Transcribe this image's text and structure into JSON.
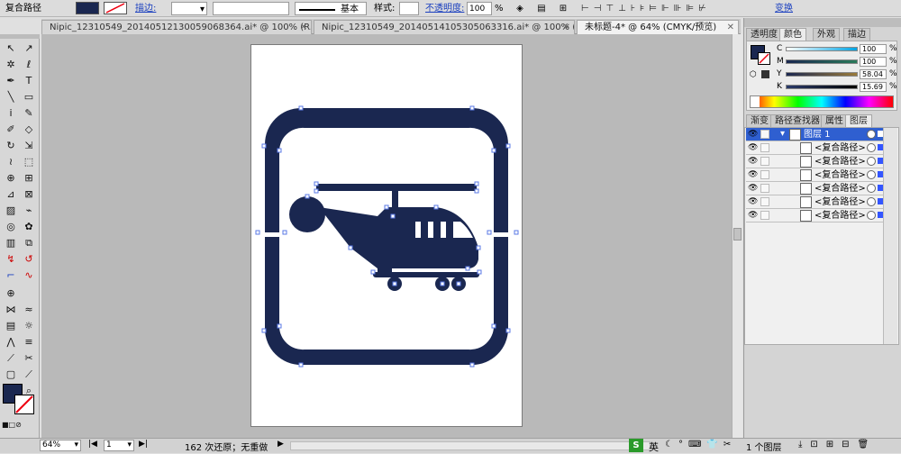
{
  "control_bar": {
    "object_type": "复合路径",
    "stroke_label": "描边:",
    "stroke_profile": "基本",
    "style_label": "样式:",
    "opacity_label": "不透明度:",
    "opacity_value": "100",
    "opacity_unit": "%",
    "transform_label": "变换"
  },
  "doc_tabs": [
    {
      "label": "Nipic_12310549_20140512130059068364.ai* @ 100% (R..."
    },
    {
      "label": "Nipic_12310549_20140514105305063316.ai* @ 100% (R..."
    },
    {
      "label": "未标题-4* @ 64% (CMYK/预览)"
    }
  ],
  "color_panel": {
    "tabs": [
      "透明度",
      "颜色",
      "外观",
      "描边"
    ],
    "channels": [
      {
        "label": "C",
        "value": "100",
        "unit": "%"
      },
      {
        "label": "M",
        "value": "100",
        "unit": "%"
      },
      {
        "label": "Y",
        "value": "58.04",
        "unit": "%"
      },
      {
        "label": "K",
        "value": "15.69",
        "unit": "%"
      }
    ],
    "fill_color": "#1a2750"
  },
  "layers_panel": {
    "tabs": [
      "渐变",
      "路径查找器",
      "属性",
      "图层"
    ],
    "layer_name": "图层 1",
    "items": [
      {
        "name": "<复合路径>"
      },
      {
        "name": "<复合路径>"
      },
      {
        "name": "<复合路径>"
      },
      {
        "name": "<复合路径>"
      },
      {
        "name": "<复合路径>"
      },
      {
        "name": "<复合路径>"
      }
    ],
    "footer_count": "1 个图层"
  },
  "status_bar": {
    "zoom": "64%",
    "page": "1",
    "history": "162 次还原；无重做"
  },
  "ime": {
    "label": "英"
  },
  "colors": {
    "accent_blue": "#1a2750",
    "selection": "#4a6fe0"
  }
}
